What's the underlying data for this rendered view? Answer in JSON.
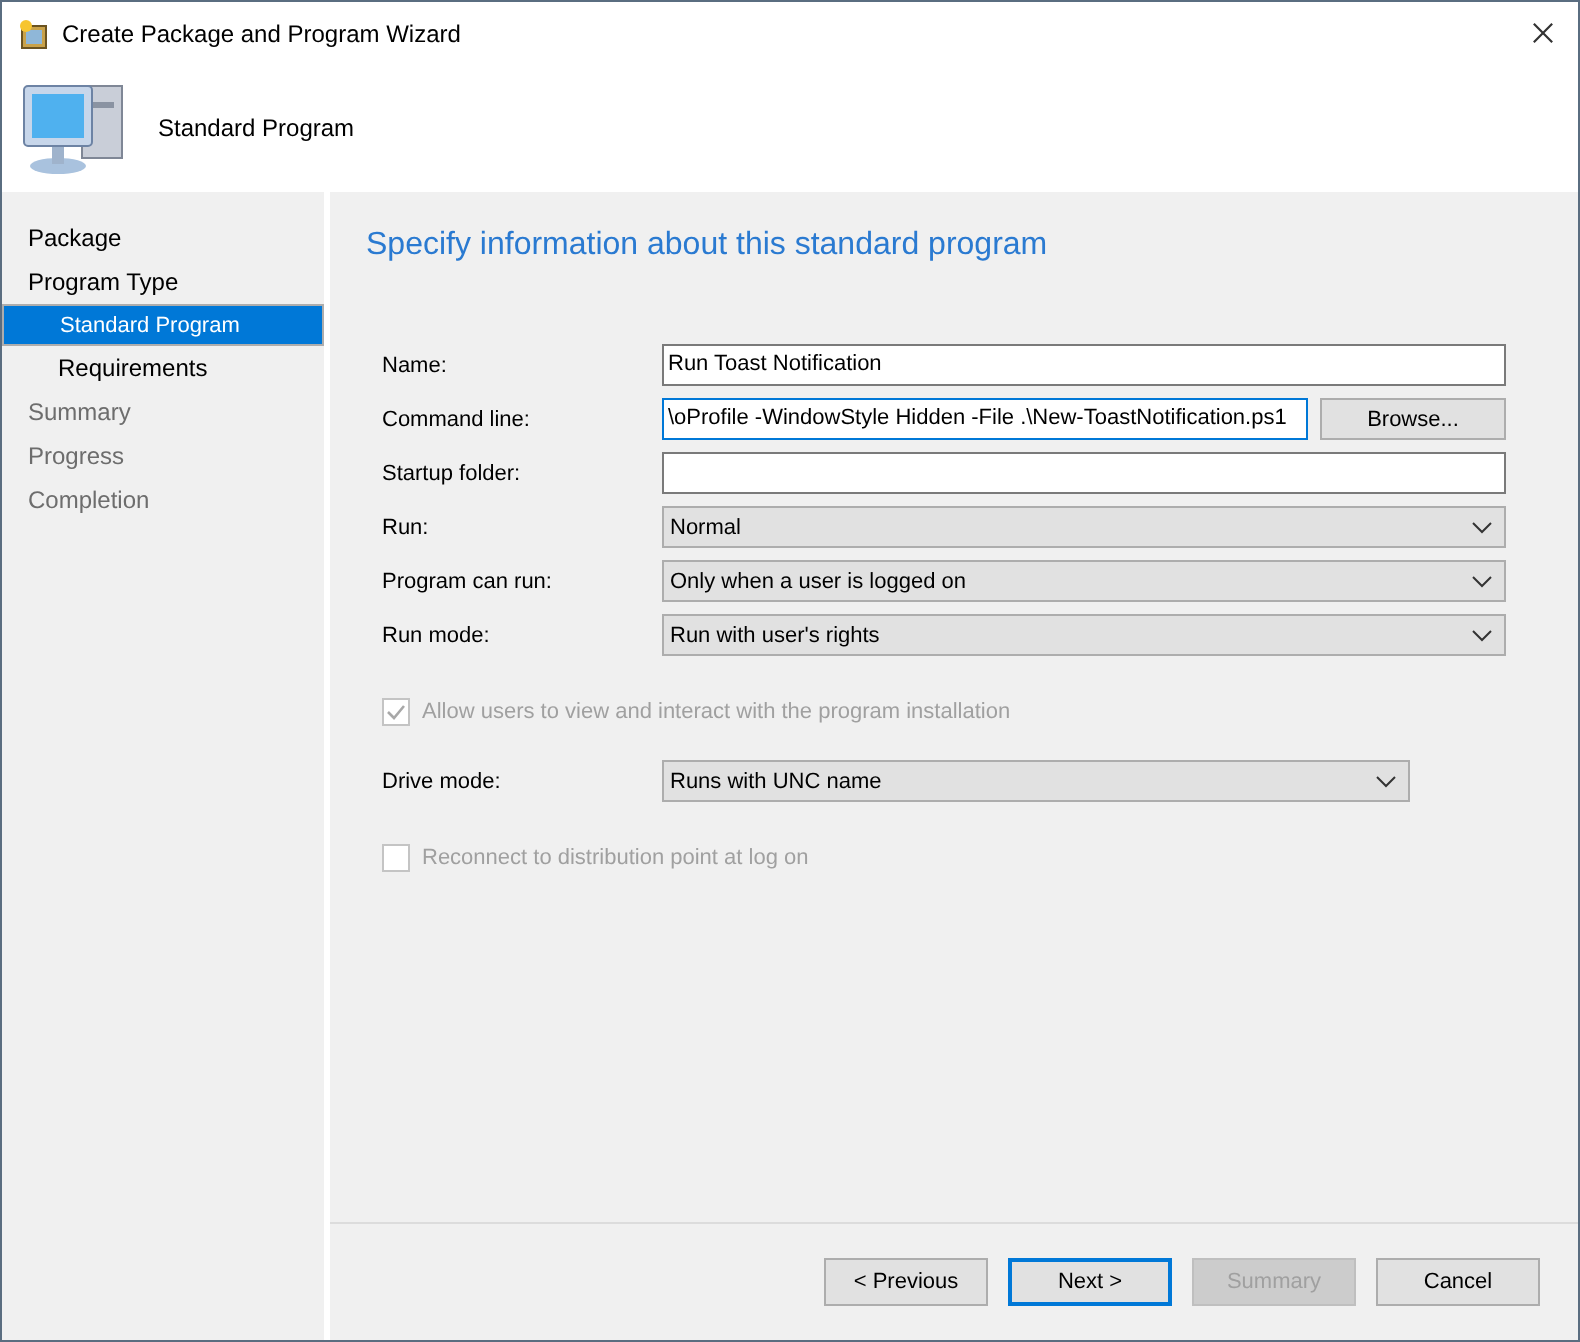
{
  "window": {
    "title": "Create Package and Program Wizard"
  },
  "header": {
    "title": "Standard Program"
  },
  "sidebar": {
    "items": [
      {
        "label": "Package",
        "selected": false,
        "disabled": false
      },
      {
        "label": "Program Type",
        "selected": false,
        "disabled": false,
        "children": [
          {
            "label": "Standard Program",
            "selected": true,
            "disabled": false
          },
          {
            "label": "Requirements",
            "selected": false,
            "disabled": false
          }
        ]
      },
      {
        "label": "Summary",
        "selected": false,
        "disabled": true
      },
      {
        "label": "Progress",
        "selected": false,
        "disabled": true
      },
      {
        "label": "Completion",
        "selected": false,
        "disabled": true
      }
    ]
  },
  "page": {
    "heading": "Specify information about this standard program",
    "rows": [
      {
        "kind": "text",
        "label": "Name:",
        "value": "Run Toast Notification",
        "focused": false
      },
      {
        "kind": "text",
        "label": "Command line:",
        "value": "\\oProfile -WindowStyle Hidden -File .\\New-ToastNotification.ps1",
        "focused": true,
        "button": "Browse..."
      },
      {
        "kind": "text",
        "label": "Startup folder:",
        "value": "",
        "focused": false
      },
      {
        "kind": "select",
        "label": "Run:",
        "value": "Normal"
      },
      {
        "kind": "select",
        "label": "Program can run:",
        "value": "Only when a user is logged on"
      },
      {
        "kind": "select",
        "label": "Run mode:",
        "value": "Run with user's rights"
      },
      {
        "kind": "checkbox",
        "label": "Allow users to view and interact with the program installation",
        "checked": true,
        "disabled": true
      },
      {
        "kind": "select",
        "label": "Drive mode:",
        "value": "Runs with UNC name",
        "short": true
      },
      {
        "kind": "checkbox",
        "label": "Reconnect to distribution point at log on",
        "checked": false,
        "disabled": true
      }
    ]
  },
  "buttons": [
    {
      "label": "< Previous",
      "default": false,
      "disabled": false
    },
    {
      "label": "Next >",
      "default": true,
      "disabled": false
    },
    {
      "label": "Summary",
      "default": false,
      "disabled": true
    },
    {
      "label": "Cancel",
      "default": false,
      "disabled": false
    }
  ]
}
